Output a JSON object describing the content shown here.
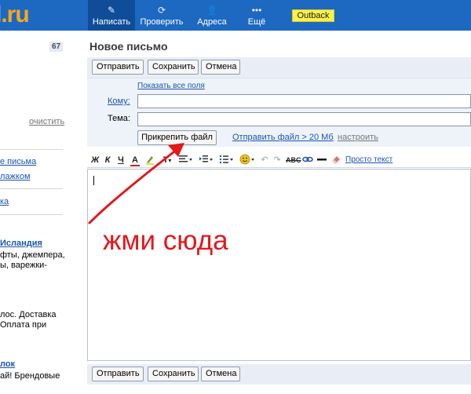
{
  "header": {
    "logo_text": "l",
    "logo_dot": ".ru",
    "nav": [
      {
        "label": "Написать",
        "icon": "pencil-icon",
        "glyph": "✎"
      },
      {
        "label": "Проверить",
        "icon": "refresh-icon",
        "glyph": "⟳"
      },
      {
        "label": "Адреса",
        "icon": "contacts-icon",
        "glyph": "👤"
      },
      {
        "label": "Ещё",
        "icon": "more-dots-icon",
        "glyph": "•••"
      }
    ],
    "promo": "Outback"
  },
  "sidebar": {
    "unread_count": "67",
    "clear_label": "очистить",
    "links": [
      "е письма",
      "лажком",
      "ка"
    ],
    "ad": {
      "title": "Исландия",
      "lines": [
        "фты, джемпера,",
        "ы, варежки-",
        "",
        "",
        "лос. Доставка",
        "Оплата при"
      ]
    },
    "ad2": {
      "title": "лок",
      "lines": [
        "ай! Брендовые"
      ]
    }
  },
  "compose": {
    "title": "Новое письмо",
    "buttons": {
      "send": "Отправить",
      "save": "Сохранить",
      "cancel": "Отмена"
    },
    "show_all_fields": "Показать все поля",
    "to_label": "Кому:",
    "subject_label": "Тема:",
    "to_value": "",
    "subject_value": "",
    "attach_label": "Прикрепить файл",
    "send_large_label": "Отправить файл > 20 Мб",
    "settings_label": "настроить",
    "format": {
      "bold": "Ж",
      "italic": "К",
      "underline": "Ч",
      "font_color": "А",
      "plain_text": "Просто текст"
    },
    "body_value": ""
  },
  "annotation": {
    "text": "жми сюда",
    "color": "#e4181c"
  },
  "colors": {
    "header_bg": "#1d68c0",
    "toolbar_bg": "#e9eef6",
    "link": "#1a55b0",
    "promo_bg": "#fbf24b"
  }
}
